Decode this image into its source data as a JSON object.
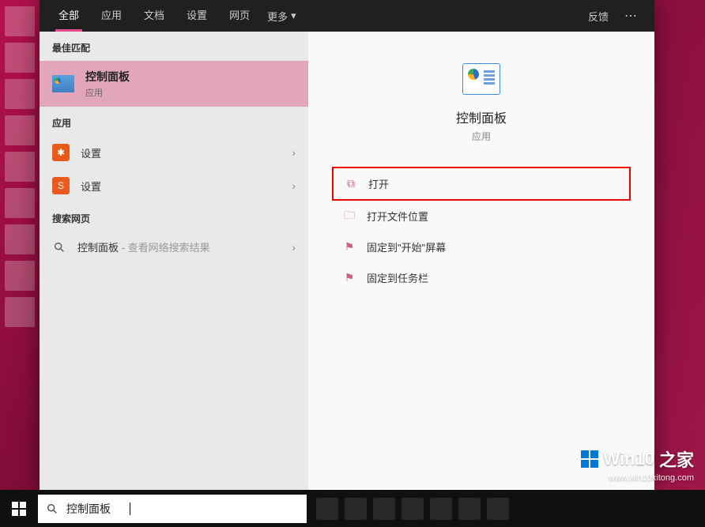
{
  "tabs": {
    "items": [
      "全部",
      "应用",
      "文档",
      "设置",
      "网页"
    ],
    "more": "更多",
    "feedback": "反馈"
  },
  "sections": {
    "best_match": "最佳匹配",
    "apps": "应用",
    "web": "搜索网页"
  },
  "best_match": {
    "title": "控制面板",
    "subtitle": "应用"
  },
  "app_results": [
    {
      "label": "设置",
      "icon": "gear"
    },
    {
      "label": "设置",
      "icon": "sogou"
    }
  ],
  "web_result": {
    "term": "控制面板",
    "hint": " - 查看网络搜索结果"
  },
  "detail": {
    "title": "控制面板",
    "subtitle": "应用",
    "actions": [
      {
        "label": "打开",
        "icon": "open",
        "highlighted": true
      },
      {
        "label": "打开文件位置",
        "icon": "folder",
        "highlighted": false
      },
      {
        "label": "固定到\"开始\"屏幕",
        "icon": "pin",
        "highlighted": false
      },
      {
        "label": "固定到任务栏",
        "icon": "pin",
        "highlighted": false
      }
    ]
  },
  "search": {
    "value": "控制面板",
    "placeholder": ""
  },
  "watermark": {
    "brand_pre": "Win10",
    "brand_post": "之家",
    "url": "www.win10xitong.com"
  }
}
